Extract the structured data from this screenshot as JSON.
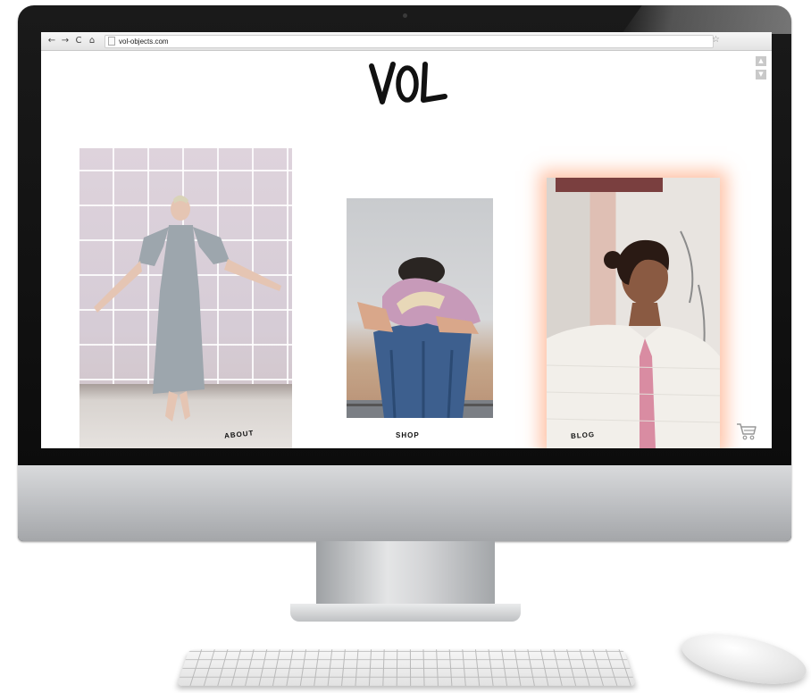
{
  "browser": {
    "back_icon": "←",
    "forward_icon": "→",
    "reload_icon": "C",
    "home_icon": "⌂",
    "url": "vol-objects.com",
    "bookmark_icon": "☆",
    "scroll_up_icon": "▲",
    "scroll_down_icon": "▼"
  },
  "site": {
    "logo_text": "VOL",
    "tiles": [
      {
        "label": "ABOUT"
      },
      {
        "label": "SHOP"
      },
      {
        "label": "BLOG"
      }
    ]
  },
  "colors": {
    "blog_glow": "#ff9664",
    "bezel": "#111111",
    "chin": "#c4c6c9"
  }
}
